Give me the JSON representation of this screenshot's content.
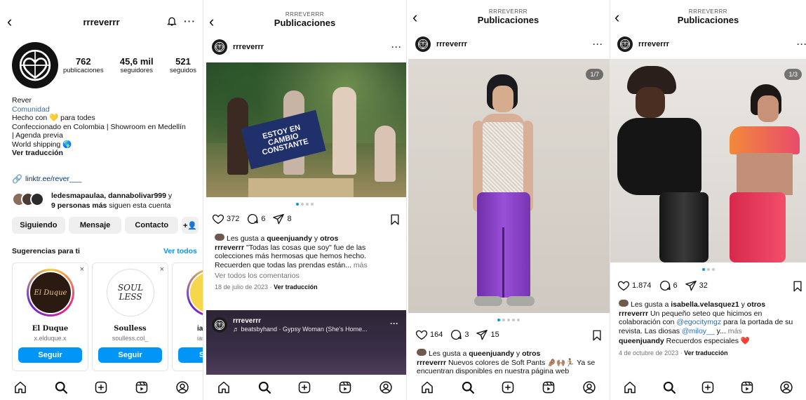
{
  "profile": {
    "username": "rrreverrr",
    "stats": [
      {
        "num": "762",
        "label": "publicaciones"
      },
      {
        "num": "45,6 mil",
        "label": "seguidores"
      },
      {
        "num": "521",
        "label": "seguidos"
      }
    ],
    "name": "Rever",
    "category": "Comunidad",
    "bio_lines": [
      "Hecho con 💛 para todes",
      "Confeccionado en Colombia | Showroom en Medellín",
      "| Agenda previa",
      "World shipping 🌎"
    ],
    "see_translation": "Ver traducción",
    "link": "linktr.ee/rever___",
    "followers_names": "ledesmapaulaa, dannabolivar999",
    "followers_and": " y",
    "followers_more": "9 personas más",
    "followers_suffix": " siguen esta cuenta",
    "buttons": {
      "following": "Siguiendo",
      "message": "Mensaje",
      "contact": "Contacto"
    },
    "suggestions_title": "Sugerencias para ti",
    "see_all": "Ver todos",
    "suggestions": [
      {
        "name": "El Duque",
        "handle": "x.elduque.x",
        "follow": "Seguir",
        "logo": "El Duque"
      },
      {
        "name": "Soulless",
        "handle": "soulless.col_",
        "follow": "Seguir",
        "logo": "SOUL LESS"
      },
      {
        "name": "ias",
        "handle": "ias",
        "follow": "Se"
      }
    ]
  },
  "feed_header": {
    "account": "RRREVERRR",
    "title": "Publicaciones"
  },
  "post1": {
    "username": "rrreverrr",
    "banner": [
      "ESTOY EN",
      "CAMBIO",
      "CONSTANTE"
    ],
    "likes": "372",
    "comments": "6",
    "shares": "8",
    "liked_by_prefix": "Les gusta a ",
    "liked_by_user": "queenjuandy",
    "liked_by_and": " y ",
    "liked_by_others": "otros",
    "caption_user": "rrreverrr",
    "caption": " \"Todas las cosas que soy\" fue de las colecciones más hermosas que hemos hecho. Recuerden que todas las prendas están...",
    "more": " más",
    "view_comments": "Ver todos los comentarios",
    "date": "18 de julio de 2023",
    "see_translation": "Ver traducción"
  },
  "post1b": {
    "username": "rrreverrr",
    "audio": "beatsbyhand · Gypsy Woman (She's Home..."
  },
  "post2": {
    "username": "rrreverrr",
    "counter": "1/7",
    "likes": "164",
    "comments": "3",
    "shares": "15",
    "liked_by_prefix": "Les gusta a ",
    "liked_by_user": "queenjuandy",
    "liked_by_and": " y ",
    "liked_by_others": "otros",
    "caption_user": "rrreverrr",
    "caption": " Nuevos colores de Soft Pants 🤌🏽🙌🏽🏃🏽 Ya se encuentran disponibles en nuestra página web"
  },
  "post3": {
    "username": "rrreverrr",
    "counter": "1/3",
    "likes": "1.874",
    "comments": "6",
    "shares": "32",
    "liked_by_prefix": "Les gusta a ",
    "liked_by_user": "isabella.velasquez1",
    "liked_by_and": " y ",
    "liked_by_others": "otros",
    "caption_user": "rrreverrr",
    "caption_a": " Un pequeño seteo que hicimos en colaboración con ",
    "mention1": "@egocitymgz",
    "caption_b": " para la portada de su revista. Las diosas ",
    "mention2": "@miloy__",
    "caption_c": " y...",
    "more": " más",
    "comment_user": "queenjuandy",
    "comment_text": " Recuerdos especiales ❤️",
    "date": "4 de octubre de 2023",
    "see_translation": "Ver traducción"
  },
  "icons": [
    "back-icon",
    "bell-icon",
    "more-icon",
    "heart-icon",
    "comment-icon",
    "share-icon",
    "bookmark-icon",
    "home-icon",
    "search-icon",
    "create-icon",
    "reels-icon",
    "profile-icon",
    "link-icon",
    "add-person-icon",
    "close-icon",
    "music-icon"
  ],
  "colors": {
    "accent": "#0095f6",
    "link": "#00376b",
    "purple": "#8a3fc2",
    "heart": "#ed4956"
  }
}
